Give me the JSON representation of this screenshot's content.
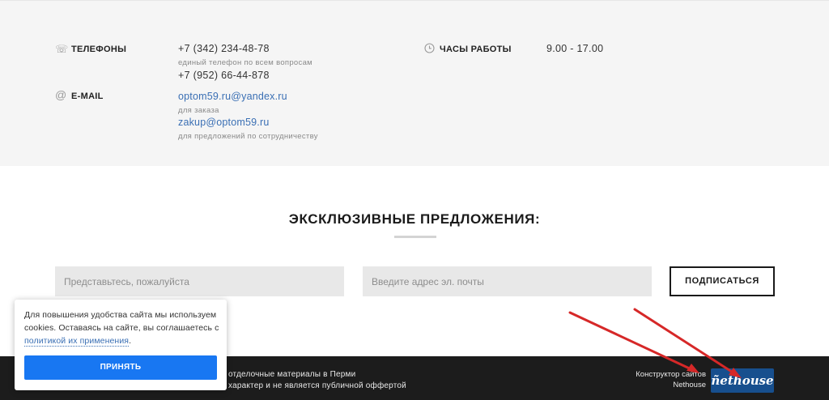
{
  "contacts": {
    "phones_label": "ТЕЛЕФОНЫ",
    "phone_1": "+7 (342) 234-48-78",
    "phone_1_note": "единый телефон по всем вопросам",
    "phone_2": "+7 (952) 66-44-878",
    "email_label": "E-MAIL",
    "email_1": "optom59.ru@yandex.ru",
    "email_1_note": "для заказа",
    "email_2": "zakup@optom59.ru",
    "email_2_note": "для предложений по сотрудничеству",
    "hours_label": "ЧАСЫ РАБОТЫ",
    "hours_value": "9.00 - 17.00"
  },
  "subscribe": {
    "title": "ЭКСКЛЮЗИВНЫЕ ПРЕДЛОЖЕНИЯ:",
    "name_placeholder": "Представьтесь, пожалуйста",
    "email_placeholder": "Введите адрес эл. почты",
    "button_label": "ПОДПИСАТЬСЯ"
  },
  "footer": {
    "text_line_1": "отделочные материалы в Перми",
    "text_line_2": "характер и не является публичной оффертой",
    "credit_line_1": "Конструктор сайтов",
    "credit_line_2": "Nethouse",
    "logo_text": "ñethouse"
  },
  "cookie": {
    "text": "Для повышения удобства сайта мы используем cookies. Оставаясь на сайте, вы соглашаетесь с",
    "link_text": "политикой их применения",
    "after_link": ".",
    "accept_label": "ПРИНЯТЬ"
  },
  "annotation": {
    "color": "#d62828"
  }
}
